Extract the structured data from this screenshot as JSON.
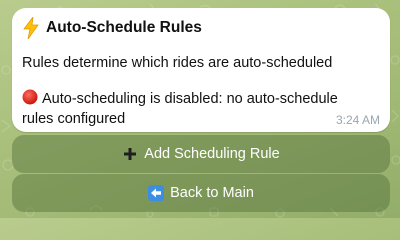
{
  "message": {
    "title_icon": "lightning-bolt-icon",
    "title": "Auto-Schedule Rules",
    "line1": "Rules determine which rides are auto-scheduled",
    "status_icon": "red-circle-icon",
    "status_text": "Auto-scheduling is disabled: no auto-schedule rules configured",
    "time": "3:24 AM"
  },
  "buttons": [
    {
      "icon": "plus-icon",
      "label": "Add Scheduling Rule"
    },
    {
      "icon": "back-arrow-icon",
      "label": "Back to Main"
    }
  ],
  "colors": {
    "background": "#a9c07c",
    "bubble": "#ffffff",
    "button_bg": "#6f8a55",
    "timestamp": "#9aa6b2",
    "status_red": "#d7261e",
    "bolt_yellow": "#ffc107"
  }
}
